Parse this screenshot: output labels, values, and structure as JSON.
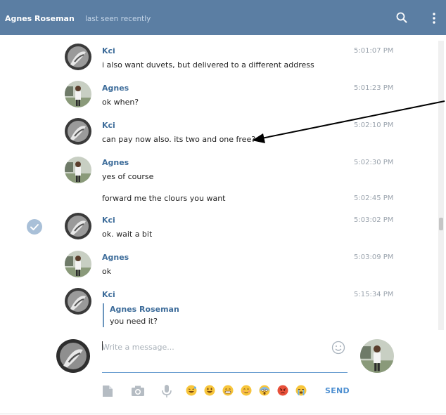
{
  "header": {
    "contact_name": "Agnes Roseman",
    "status": "last seen recently",
    "background": "#5b7ea3"
  },
  "messages": [
    {
      "sender": "Kci",
      "text": "i also want duvets, but delivered to a different address",
      "time": "5:01:07 PM"
    },
    {
      "sender": "Agnes",
      "text": "ok when?",
      "time": "5:01:23 PM"
    },
    {
      "sender": "Kci",
      "text": "can pay now also. its two and one free?",
      "time": "5:02:10 PM"
    },
    {
      "sender": "Agnes",
      "text": "yes of course",
      "time": "5:02:30 PM"
    },
    {
      "sender": "",
      "text": "forward me the clours you want",
      "time": "5:02:45 PM"
    },
    {
      "sender": "Kci",
      "text": "ok. wait a bit",
      "time": "5:03:02 PM"
    },
    {
      "sender": "Agnes",
      "text": "ok",
      "time": "5:03:09 PM"
    },
    {
      "sender": "Kci",
      "text": "",
      "time": "5:15:34 PM",
      "reply": {
        "name": "Agnes Roseman",
        "text": "you need it?"
      }
    }
  ],
  "composer": {
    "placeholder": "Write a message...",
    "send_label": "SEND",
    "accent": "#4d8fd1"
  },
  "icons": {
    "toolbar": [
      "file-icon",
      "camera-icon",
      "microphone-icon"
    ],
    "emojis": [
      "sweat-smile-emoji",
      "smiley-emoji",
      "grin-emoji",
      "blush-emoji",
      "scream-emoji",
      "angry-emoji",
      "sob-emoji"
    ]
  }
}
